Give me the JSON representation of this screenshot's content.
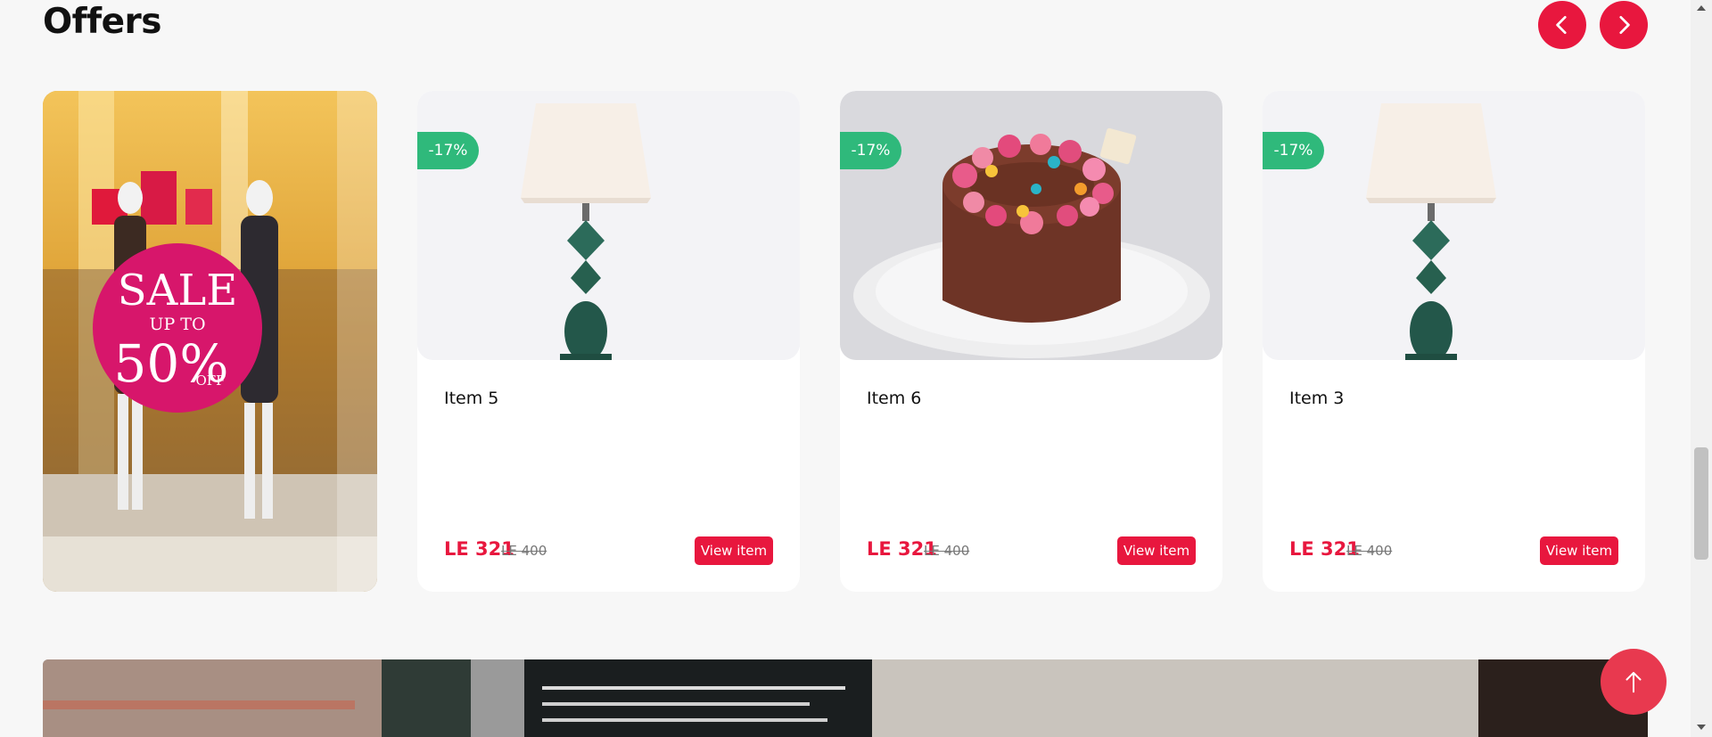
{
  "section": {
    "title": "Offers"
  },
  "nav": {
    "prev_icon": "chevron-left-icon",
    "next_icon": "chevron-right-icon"
  },
  "promo_banner": {
    "sign_line1": "SALE",
    "sign_line2": "UP TO",
    "sign_line3": "50%",
    "sign_line4": "OFF"
  },
  "cards": [
    {
      "badge": "-17%",
      "name": "Item 5",
      "price": "LE 321",
      "old_price": "LE 400",
      "button": "View item",
      "image": "table-lamp"
    },
    {
      "badge": "-17%",
      "name": "Item 6",
      "price": "LE 321",
      "old_price": "LE 400",
      "button": "View item",
      "image": "chocolate-cake"
    },
    {
      "badge": "-17%",
      "name": "Item 3",
      "price": "LE 321",
      "old_price": "LE 400",
      "button": "View item",
      "image": "table-lamp"
    }
  ],
  "scroll_top": {
    "icon": "arrow-up-icon"
  },
  "colors": {
    "accent": "#e8173e",
    "badge": "#2fb97b",
    "background": "#f7f7f7"
  }
}
